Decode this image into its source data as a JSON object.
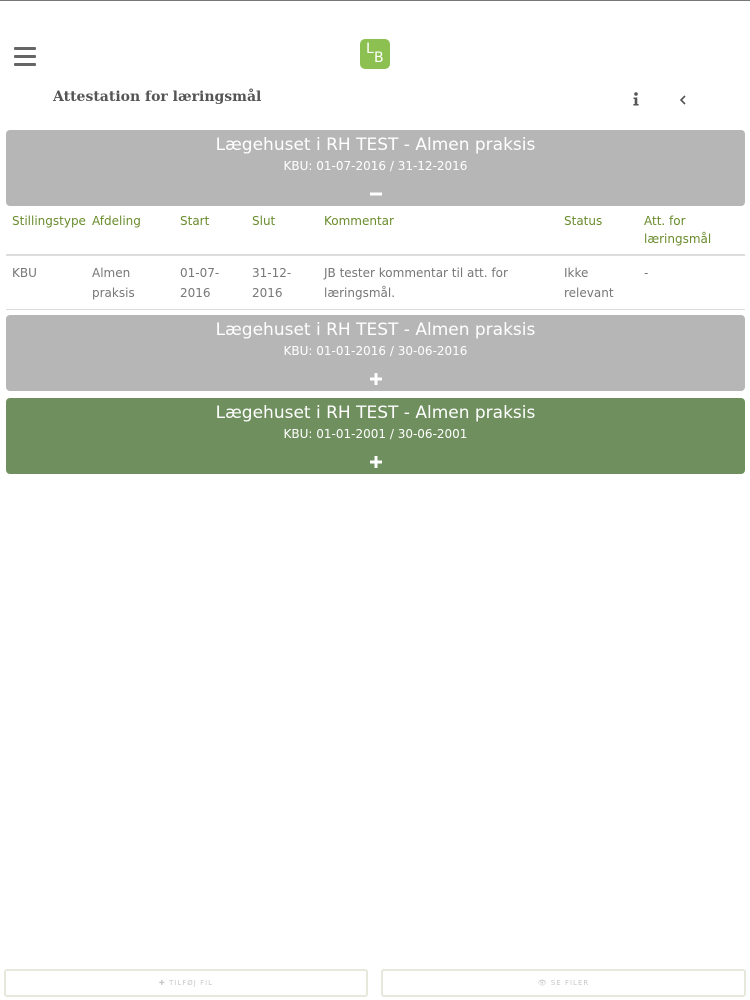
{
  "header": {
    "logo_text_l": "L",
    "logo_text_b": "B",
    "page_title": "Attestation for læringsmål"
  },
  "icons": {
    "menu": "hamburger-icon",
    "info": "info-icon",
    "back": "chevron-left-icon"
  },
  "colors": {
    "accent_green": "#8cc152",
    "header_text_green": "#6a8c2e",
    "panel_gray": "#b6b6b6",
    "panel_green": "#6f8f5e"
  },
  "panels": [
    {
      "title": "Lægehuset i RH TEST - Almen praksis",
      "subtitle": "KBU: 01-07-2016 / 31-12-2016",
      "state": "expanded",
      "toggle_icon": "minus-icon"
    },
    {
      "title": "Lægehuset i RH TEST - Almen praksis",
      "subtitle": "KBU: 01-01-2016 / 30-06-2016",
      "state": "collapsed",
      "toggle_icon": "plus-icon"
    },
    {
      "title": "Lægehuset i RH TEST - Almen praksis",
      "subtitle": "KBU: 01-01-2001 / 30-06-2001",
      "state": "collapsed",
      "toggle_icon": "plus-icon"
    }
  ],
  "table": {
    "columns": [
      "Stillingstype",
      "Afdeling",
      "Start",
      "Slut",
      "Kommentar",
      "Status",
      "Att. for læringsmål"
    ],
    "rows": [
      [
        "KBU",
        "Almen praksis",
        "01-07-2016",
        "31-12-2016",
        "JB tester kommentar til att. for læringsmål.",
        "Ikke relevant",
        "-"
      ]
    ]
  },
  "bottom_buttons": {
    "add_file": "✚ TILFØJ FIL",
    "view_files": "👁 SE FILER"
  }
}
